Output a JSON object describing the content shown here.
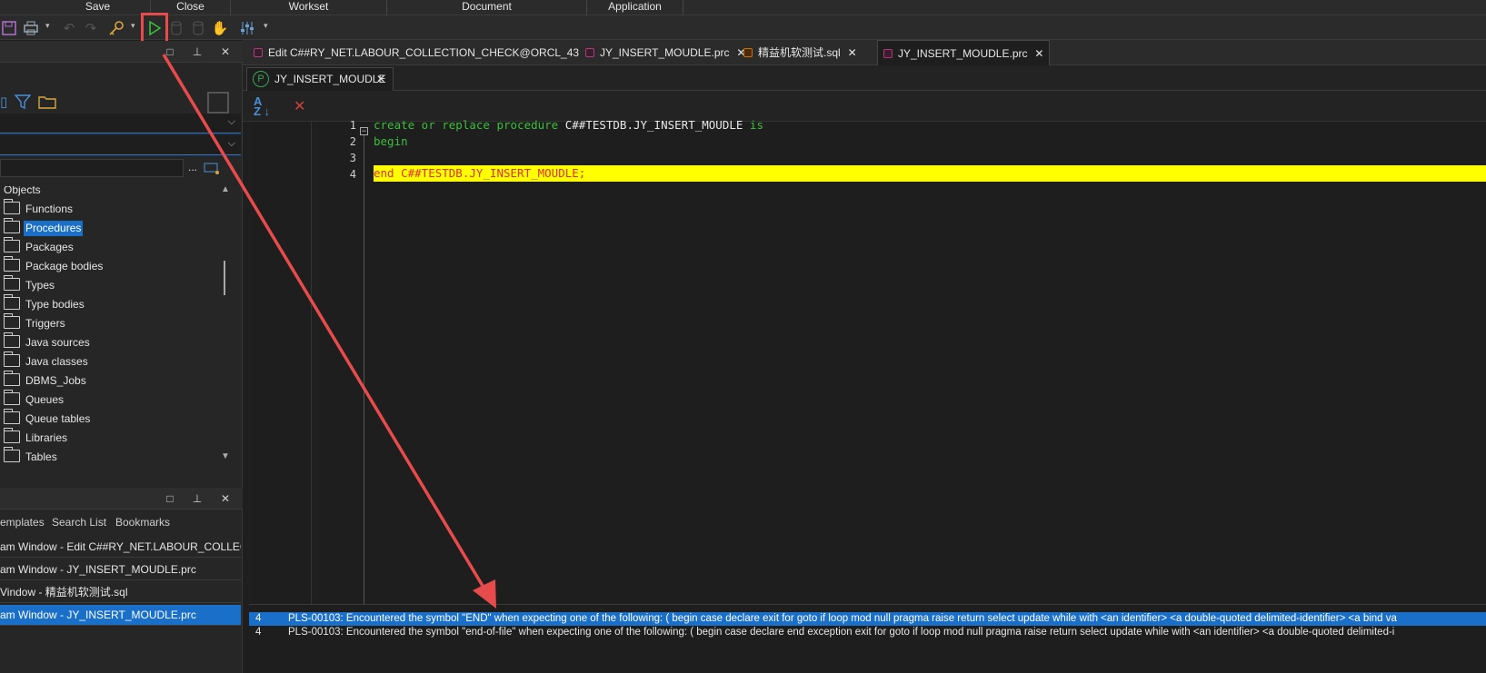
{
  "ribbon": {
    "groups": [
      "Save",
      "Close",
      "Workset",
      "Document",
      "Application"
    ]
  },
  "toolbar": {
    "icons": [
      "save-icon",
      "print-icon",
      "undo-icon",
      "redo-icon",
      "key-icon",
      "execute-icon",
      "commit-icon",
      "rollback-icon",
      "break-icon",
      "settings-icon"
    ]
  },
  "object_browser": {
    "root_label": "Objects",
    "search_dots": "...",
    "items": [
      {
        "label": "Functions"
      },
      {
        "label": "Procedures",
        "selected": true
      },
      {
        "label": "Packages"
      },
      {
        "label": "Package bodies"
      },
      {
        "label": "Types"
      },
      {
        "label": "Type bodies"
      },
      {
        "label": "Triggers"
      },
      {
        "label": "Java sources"
      },
      {
        "label": "Java classes"
      },
      {
        "label": "DBMS_Jobs"
      },
      {
        "label": "Queues"
      },
      {
        "label": "Queue tables"
      },
      {
        "label": "Libraries"
      },
      {
        "label": "Tables"
      }
    ]
  },
  "window_list": {
    "tabs": [
      "emplates",
      "Search List",
      "Bookmarks"
    ],
    "items": [
      {
        "label": "am Window - Edit C##RY_NET.LABOUR_COLLECTI"
      },
      {
        "label": "am Window - JY_INSERT_MOUDLE.prc"
      },
      {
        "label": "Vindow - 精益机软测试.sql"
      },
      {
        "label": "am Window - JY_INSERT_MOUDLE.prc",
        "selected": true
      }
    ]
  },
  "doc_tabs": [
    {
      "label": "Edit C##RY_NET.LABOUR_COLLECTION_CHECK@ORCL_43",
      "close": "✕"
    },
    {
      "label": "JY_INSERT_MOUDLE.prc",
      "close": "✕"
    },
    {
      "label": "精益机软测试.sql",
      "close": "✕"
    },
    {
      "label": "JY_INSERT_MOUDLE.prc",
      "close": "✕",
      "active": true
    }
  ],
  "sub_tab": {
    "badge": "P",
    "label": "JY_INSERT_MOUDLE",
    "close": "✕"
  },
  "editor": {
    "line_numbers": [
      "1",
      "2",
      "3",
      "4"
    ],
    "lines": {
      "l1_kw1": "create or replace procedure",
      "l1_id": " C##TESTDB.JY_INSERT_MOUDLE ",
      "l1_kw2": "is",
      "l2": "begin",
      "l3": "",
      "l4": "end C##TESTDB.JY_INSERT_MOUDLE;"
    },
    "error_line_color": "#ffff00"
  },
  "errors": [
    {
      "line": "4",
      "message": "PLS-00103: Encountered the symbol \"END\" when expecting one of the following:       ( begin case declare exit for goto if loop mod null pragma     raise return select update while with <an identifier>     <a double-quoted delimited-identifier> <a bind va",
      "selected": true
    },
    {
      "line": "4",
      "message": "PLS-00103: Encountered the symbol \"end-of-file\" when expecting one of the following:      ( begin case declare end exception exit for goto if loop mod     null pragma raise return select update while with     <an identifier> <a double-quoted delimited-i"
    }
  ],
  "colors": {
    "accent": "#1a6fc9",
    "annotation": "#e84b4b",
    "keyword": "#3bbf3b",
    "error_text": "#e03030"
  }
}
